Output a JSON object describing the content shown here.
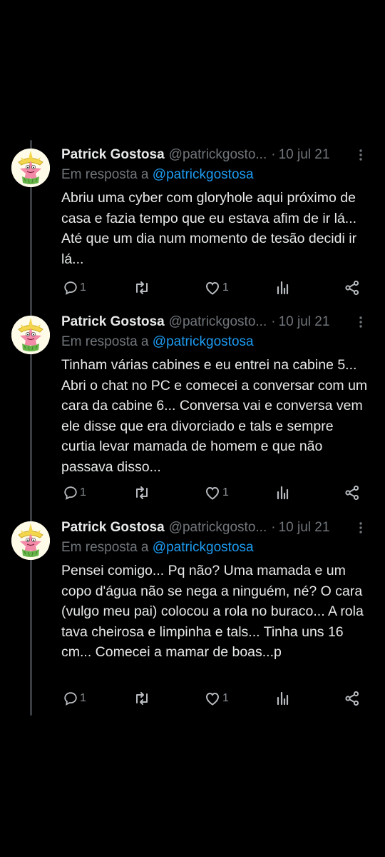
{
  "colors": {
    "background": "#000000",
    "text": "#e7e9ea",
    "secondary": "#71767b",
    "link": "#1d9bf0",
    "thread_line": "#3a3d41"
  },
  "tweets": [
    {
      "display_name": "Patrick Gostosa",
      "handle": "@patrickgosto...",
      "separator": "·",
      "date": "10 jul 21",
      "reply_prefix": "Em resposta a",
      "reply_to": "@patrickgostosa",
      "text": "Abriu uma cyber com gloryhole aqui próximo de casa e fazia tempo que eu estava afim de ir lá... Até que um dia num momento de tesão decidi ir lá...",
      "reply_count": "1",
      "retweet_count": "",
      "like_count": "1"
    },
    {
      "display_name": "Patrick Gostosa",
      "handle": "@patrickgosto...",
      "separator": "·",
      "date": "10 jul 21",
      "reply_prefix": "Em resposta a",
      "reply_to": "@patrickgostosa",
      "text": "Tinham várias cabines e eu entrei na cabine 5... Abri o chat no PC e comecei a conversar com um cara da cabine 6... Conversa vai e conversa vem ele disse que era divorciado e tals e sempre curtia levar mamada de homem e que não passava disso...",
      "reply_count": "1",
      "retweet_count": "",
      "like_count": "1"
    },
    {
      "display_name": "Patrick Gostosa",
      "handle": "@patrickgosto...",
      "separator": "·",
      "date": "10 jul 21",
      "reply_prefix": "Em resposta a",
      "reply_to": "@patrickgostosa",
      "text": "Pensei comigo... Pq não? Uma mamada e um copo d'água não se nega a ninguém, né? O cara (vulgo meu pai) colocou a rola no buraco... A rola tava cheirosa e limpinha e tals... Tinha uns 16 cm... Comecei a mamar de boas...p",
      "reply_count": "1",
      "retweet_count": "",
      "like_count": "1"
    }
  ]
}
